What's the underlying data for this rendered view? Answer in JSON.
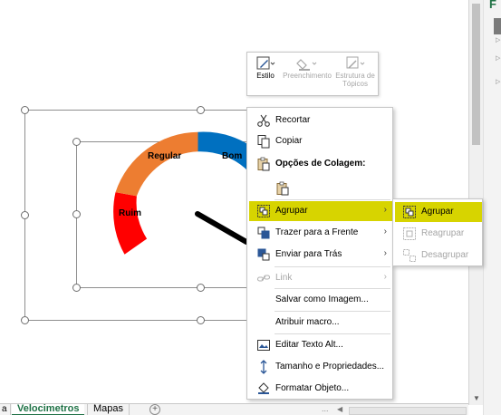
{
  "colors": {
    "highlight": "#d7d400",
    "excel_green": "#1e7145",
    "gauge_ruim": "#ff0000",
    "gauge_regular": "#ed7d31",
    "gauge_bom": "#0070c0",
    "needle": "#000000"
  },
  "side_pane": {
    "label": "F"
  },
  "gauge": {
    "segments": [
      {
        "label": "Ruim",
        "color": "#ff0000"
      },
      {
        "label": "Regular",
        "color": "#ed7d31"
      },
      {
        "label": "Bom",
        "color": "#0070c0"
      }
    ]
  },
  "mini_toolbar": {
    "buttons": [
      {
        "label": "Estilo",
        "icon": "shape-style-icon",
        "enabled": true
      },
      {
        "label": "Preenchimento",
        "icon": "paint-bucket-icon",
        "enabled": false
      },
      {
        "label": "Estrutura de Tópicos",
        "icon": "outline-pen-icon",
        "enabled": false
      }
    ]
  },
  "context_menu": {
    "items": [
      {
        "label": "Recortar",
        "icon": "scissors-icon"
      },
      {
        "label": "Copiar",
        "icon": "copy-icon"
      },
      {
        "label": "Opções de Colagem:",
        "icon": "paste-icon"
      },
      {
        "label": "Agrupar",
        "icon": "group-icon",
        "submenu": true,
        "highlighted": true
      },
      {
        "label": "Trazer para a Frente",
        "icon": "bring-forward-icon",
        "submenu": true
      },
      {
        "label": "Enviar para Trás",
        "icon": "send-backward-icon",
        "submenu": true
      },
      {
        "label": "Link",
        "icon": "link-icon",
        "submenu": true,
        "enabled": false
      },
      {
        "label": "Salvar como Imagem..."
      },
      {
        "label": "Atribuir macro..."
      },
      {
        "label": "Editar Texto Alt...",
        "icon": "alt-text-icon"
      },
      {
        "label": "Tamanho e Propriedades...",
        "icon": "size-icon"
      },
      {
        "label": "Formatar Objeto...",
        "icon": "format-icon"
      }
    ]
  },
  "submenu": {
    "items": [
      {
        "label": "Agrupar",
        "icon": "group-icon",
        "highlighted": true
      },
      {
        "label": "Reagrupar",
        "icon": "regroup-icon",
        "enabled": false
      },
      {
        "label": "Desagrupar",
        "icon": "ungroup-icon",
        "enabled": false
      }
    ]
  },
  "sheet_tabs": {
    "partial": "a",
    "active": "Velocimetros",
    "other": "Mapas",
    "add": "+",
    "ellipsis": "..."
  }
}
